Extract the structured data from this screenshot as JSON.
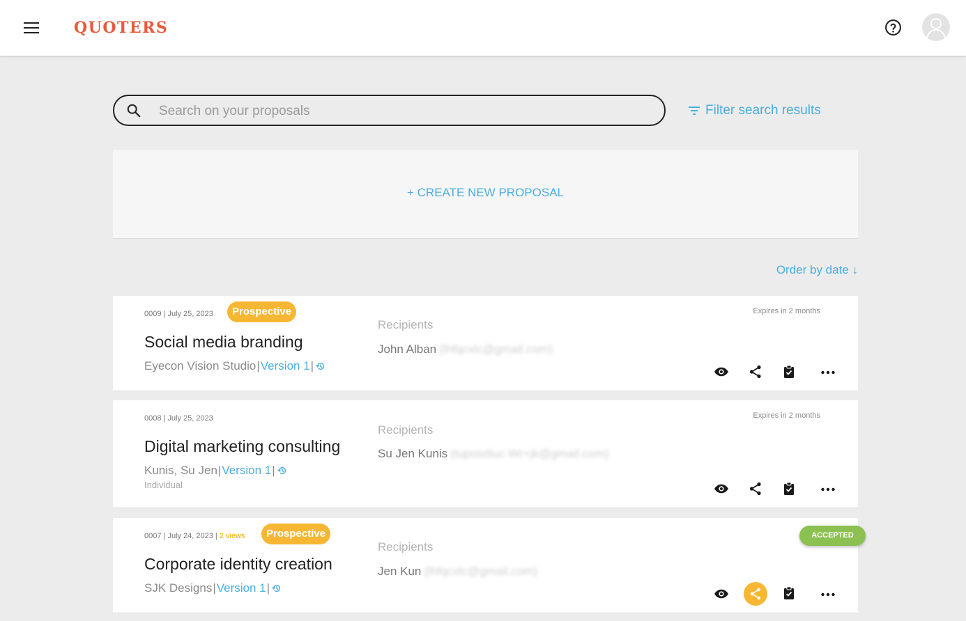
{
  "header": {
    "logo": "QUOTERS",
    "menu_icon": "hamburger-menu-icon",
    "help_icon": "help-circle-icon",
    "avatar_icon": "user-avatar-icon"
  },
  "search": {
    "placeholder": "Search on your proposals",
    "value": ""
  },
  "filter": {
    "label": "Filter search results"
  },
  "create": {
    "label": "+ CREATE NEW PROPOSAL"
  },
  "order": {
    "label": "Order by date ↓"
  },
  "colors": {
    "brand": "#e85a3c",
    "link": "#4aaee0",
    "prospective": "#f7b733",
    "accepted": "#8cc152"
  },
  "proposals": [
    {
      "meta": "0009 | July 25, 2023",
      "views": "",
      "status": "Prospective",
      "title": "Social media branding",
      "client": "Eyecon Vision Studio",
      "version": "Version 1",
      "client_type": "",
      "recipients_label": "Recipients",
      "recipient_name": "John Alban",
      "recipient_email": "(lhfqcxlc@gmail.com)",
      "expires": "Expires in 2 months",
      "accepted": ""
    },
    {
      "meta": "0008 | July 25, 2023",
      "views": "",
      "status": "",
      "title": "Digital marketing consulting",
      "client": "Kunis, Su Jen",
      "version": "Version 1",
      "client_type": "Individual",
      "recipients_label": "Recipients",
      "recipient_name": "Su Jen Kunis",
      "recipient_email": "(tuposdiuc.Wr+jk@gmail.com)",
      "expires": "Expires in 2 months",
      "accepted": ""
    },
    {
      "meta": "0007 | July 24, 2023 |",
      "views": "2 views",
      "status": "Prospective",
      "title": "Corporate identity creation",
      "client": "SJK Designs",
      "version": "Version 1",
      "client_type": "",
      "recipients_label": "Recipients",
      "recipient_name": "Jen Kun",
      "recipient_email": "(lhfqcxlc@gmail.com)",
      "expires": "",
      "accepted": "ACCEPTED"
    }
  ]
}
